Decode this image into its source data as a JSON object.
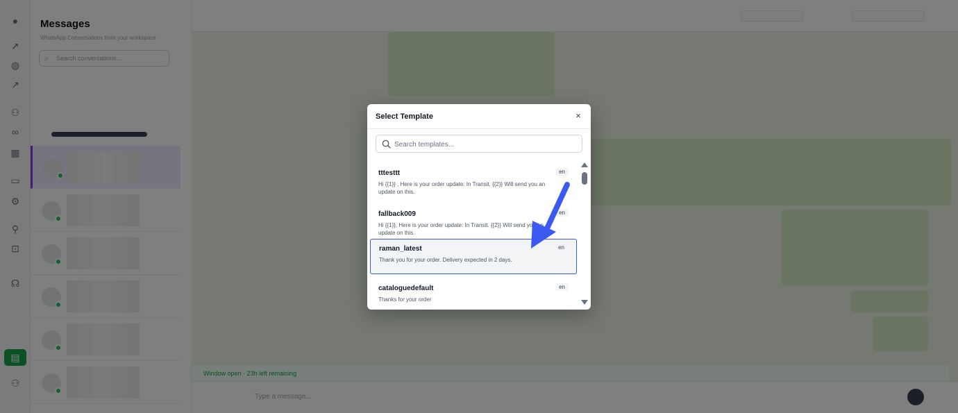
{
  "app": {
    "sidebar_title": "Messages",
    "sidebar_subtitle": "WhatsApp Conversations from your workspace",
    "search_placeholder": "Search conversations...",
    "composer_placeholder": "Type a message...",
    "banner_text": "Window open · 23h left remaining"
  },
  "modal": {
    "title": "Select Template",
    "close_glyph": "×",
    "search_placeholder": "Search templates...",
    "templates": [
      {
        "name": "tttesttt",
        "lang": "en",
        "body": "Hi {{1}} , Here is your order update: In Transit. {{2}} Will send you an update on this."
      },
      {
        "name": "fallback009",
        "lang": "en",
        "body": "Hi {{1}}, Here is your order update: In Transit. {{2}} Will send you an update on this."
      },
      {
        "name": "raman_latest",
        "lang": "en",
        "body": "Thank you for your order. Delivery expected in 2 days."
      },
      {
        "name": "cataloguedefault",
        "lang": "en",
        "body": "Thanks for your order"
      }
    ]
  },
  "colors": {
    "accent": "#3b5bdb",
    "arrow": "#3b5bf0",
    "brand_green": "#16a34a"
  },
  "icons": {
    "search": "search-icon",
    "close": "close-icon",
    "pointer": "arrow-pointer-icon"
  }
}
